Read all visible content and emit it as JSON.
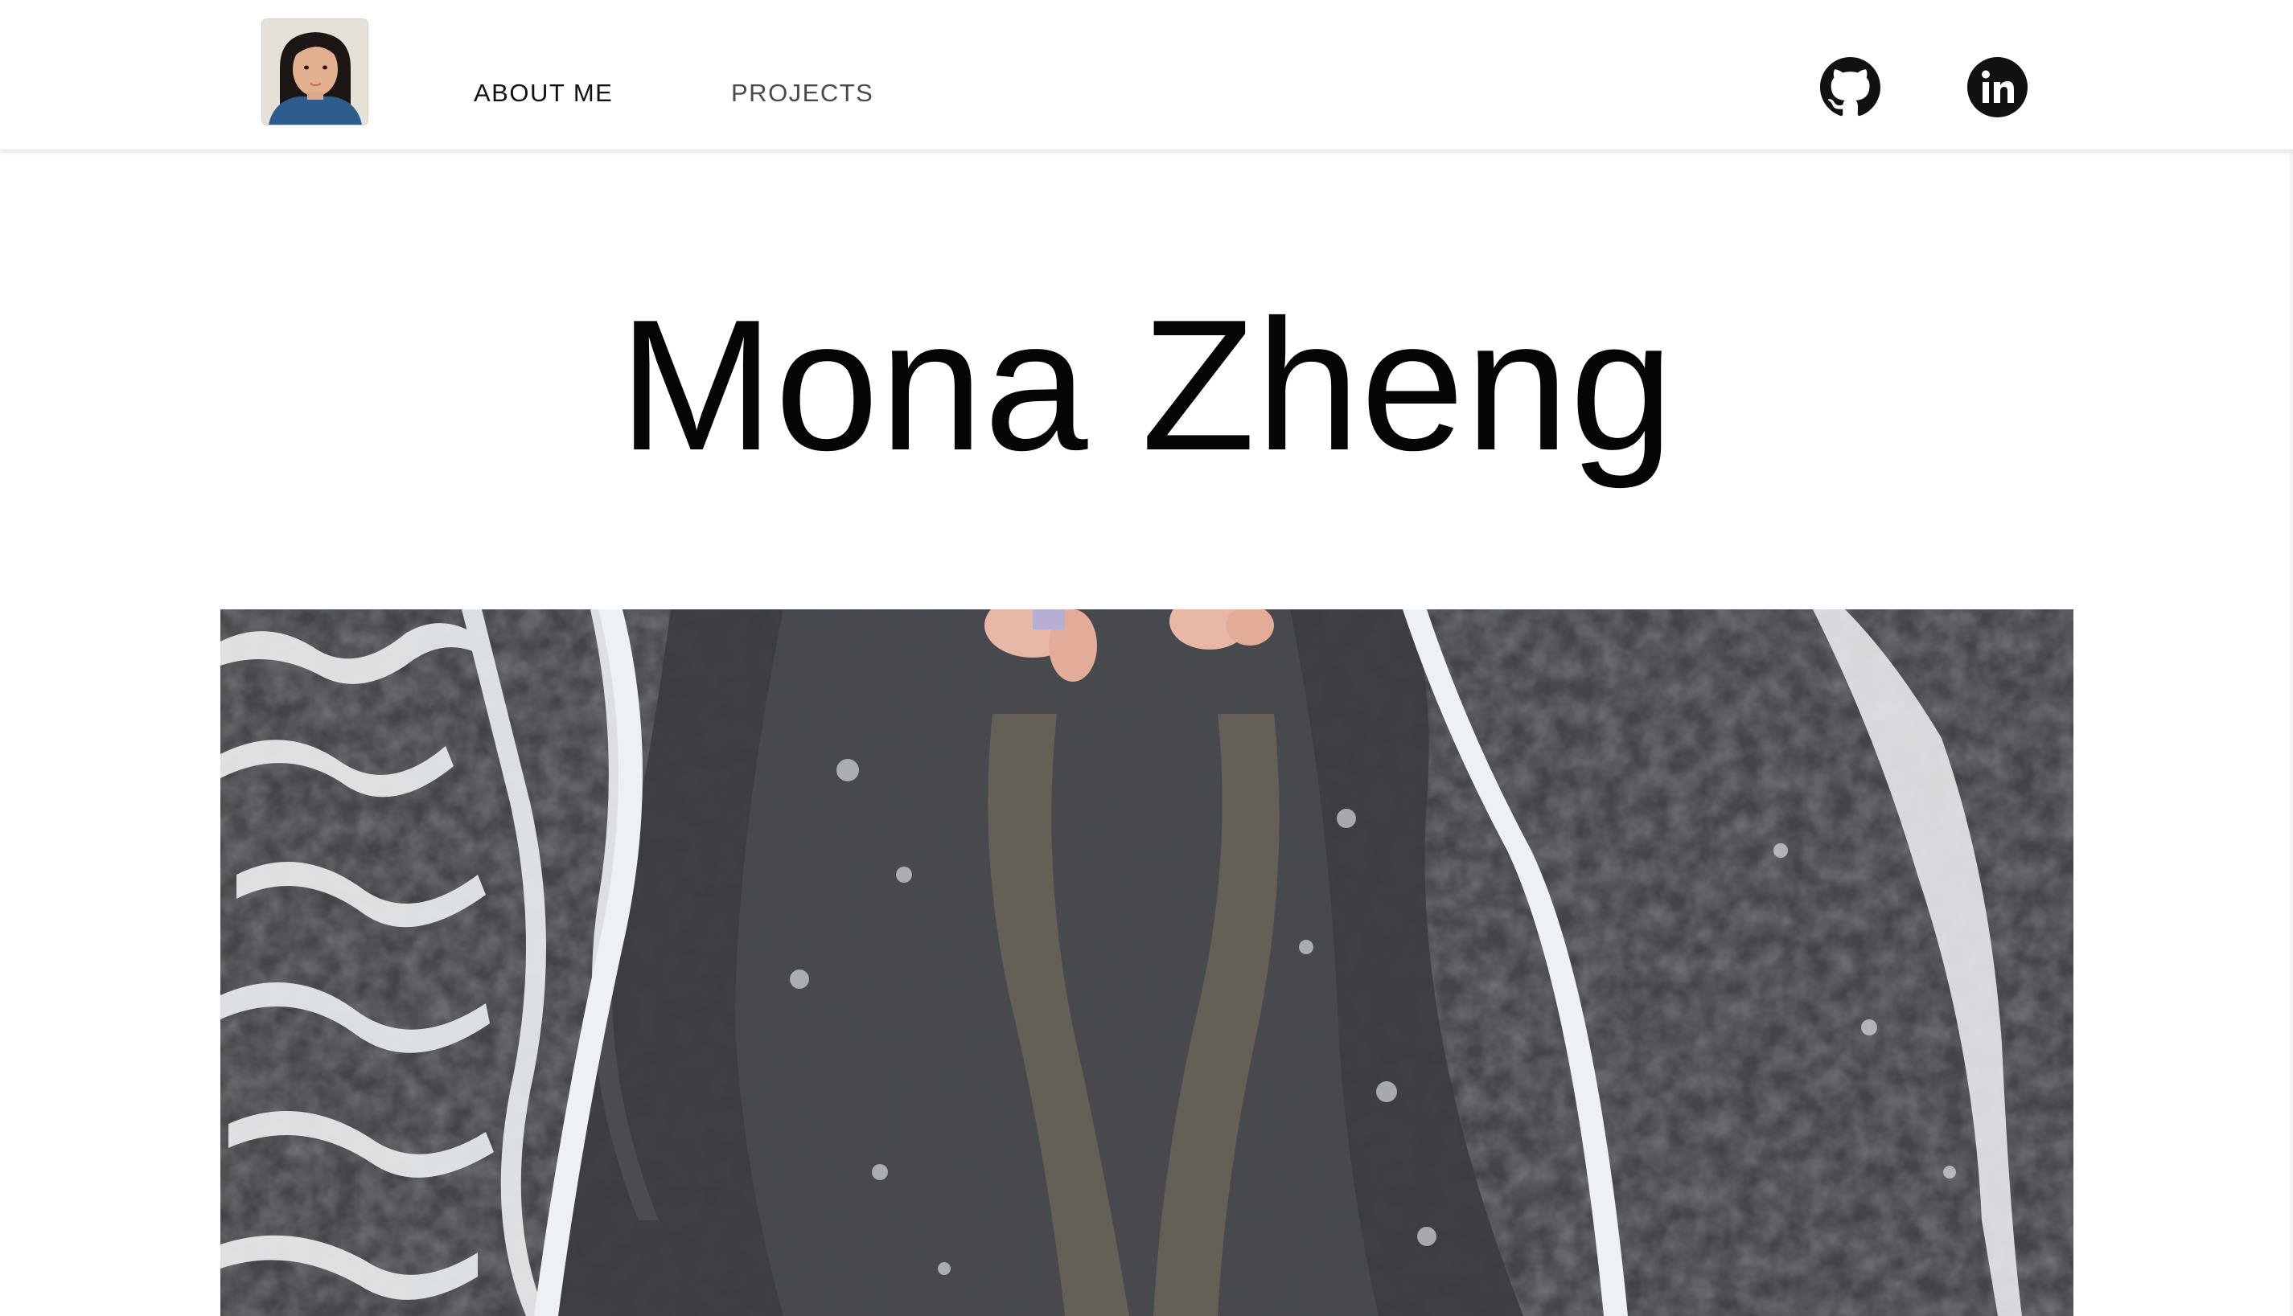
{
  "nav": {
    "about_label": "ABOUT ME",
    "projects_label": "PROJECTS",
    "active_item": "ABOUT ME",
    "avatar_icon": "profile-photo",
    "social": [
      {
        "icon": "github-icon"
      },
      {
        "icon": "linkedin-icon"
      }
    ]
  },
  "hero": {
    "title": "Mona Zheng",
    "image_subject": "beach-waves-feet-photo"
  },
  "colors": {
    "background": "#ffffff",
    "text_primary": "#050505",
    "nav_inactive": "#4a4a4a",
    "icon": "#111111"
  }
}
